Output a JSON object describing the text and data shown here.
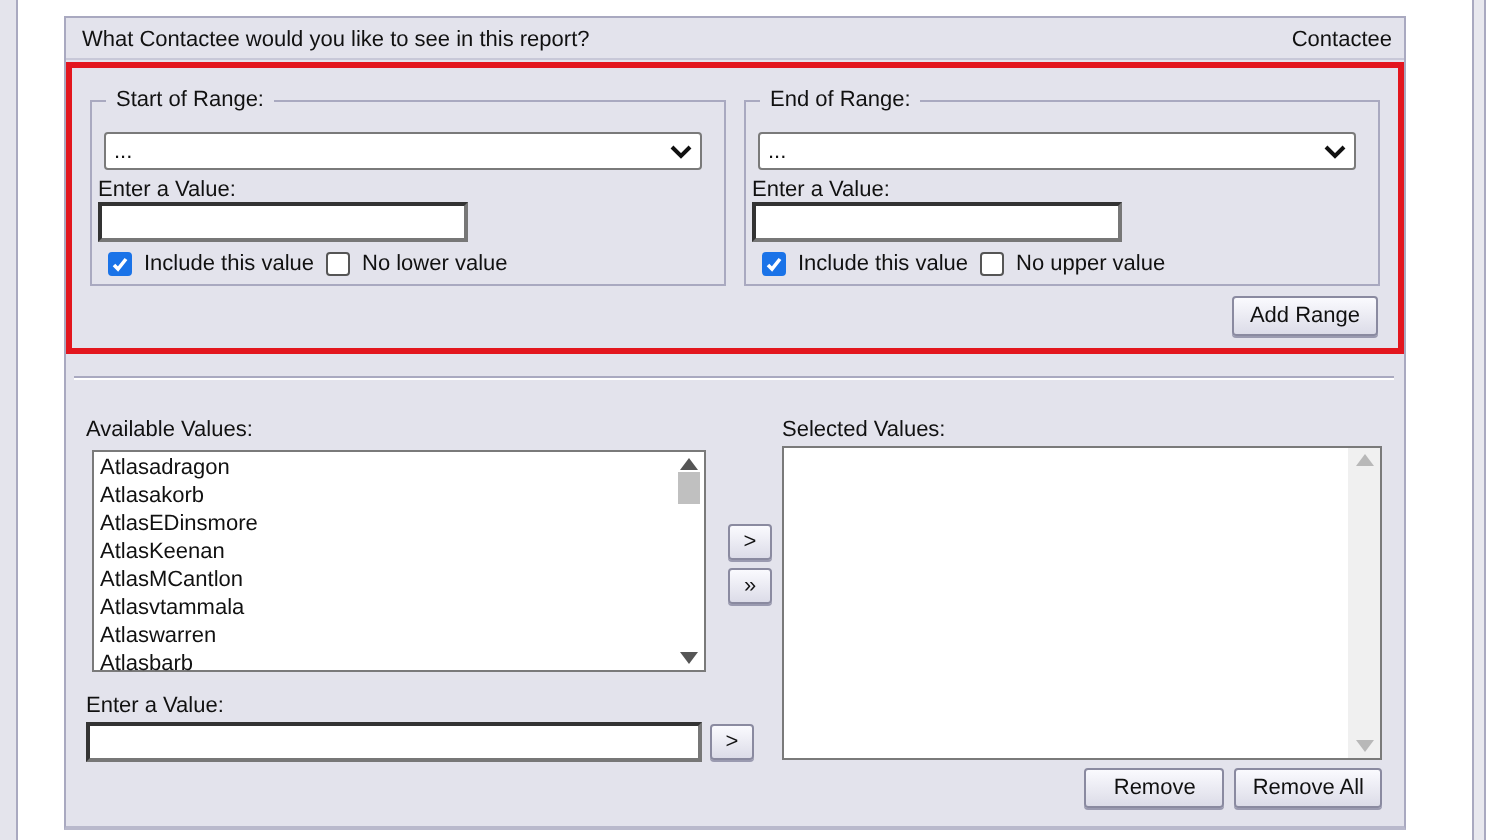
{
  "header": {
    "question": "What Contactee would you like to see in this report?",
    "field": "Contactee"
  },
  "range": {
    "bounds": [
      {
        "legend": "Start of Range:",
        "dropdown": "...",
        "value_label": "Enter a Value:",
        "include": {
          "label": "Include this value",
          "checked": true
        },
        "no_bound": {
          "label": "No lower value",
          "checked": false
        }
      },
      {
        "legend": "End of Range:",
        "dropdown": "...",
        "value_label": "Enter a Value:",
        "include": {
          "label": "Include this value",
          "checked": true
        },
        "no_bound": {
          "label": "No upper value",
          "checked": false
        }
      }
    ],
    "add_button": "Add Range"
  },
  "available": {
    "label": "Available Values:",
    "items": [
      "Atlasadragon",
      "Atlasakorb",
      "AtlasEDinsmore",
      "AtlasKeenan",
      "AtlasMCantlon",
      "Atlasvtammala",
      "Atlaswarren",
      "Atlasbarb"
    ],
    "value_label": "Enter a Value:",
    "enter_button": ">"
  },
  "move_buttons": [
    ">",
    "»"
  ],
  "selected": {
    "label": "Selected Values:"
  },
  "remove_buttons": [
    "Remove",
    "Remove All"
  ]
}
